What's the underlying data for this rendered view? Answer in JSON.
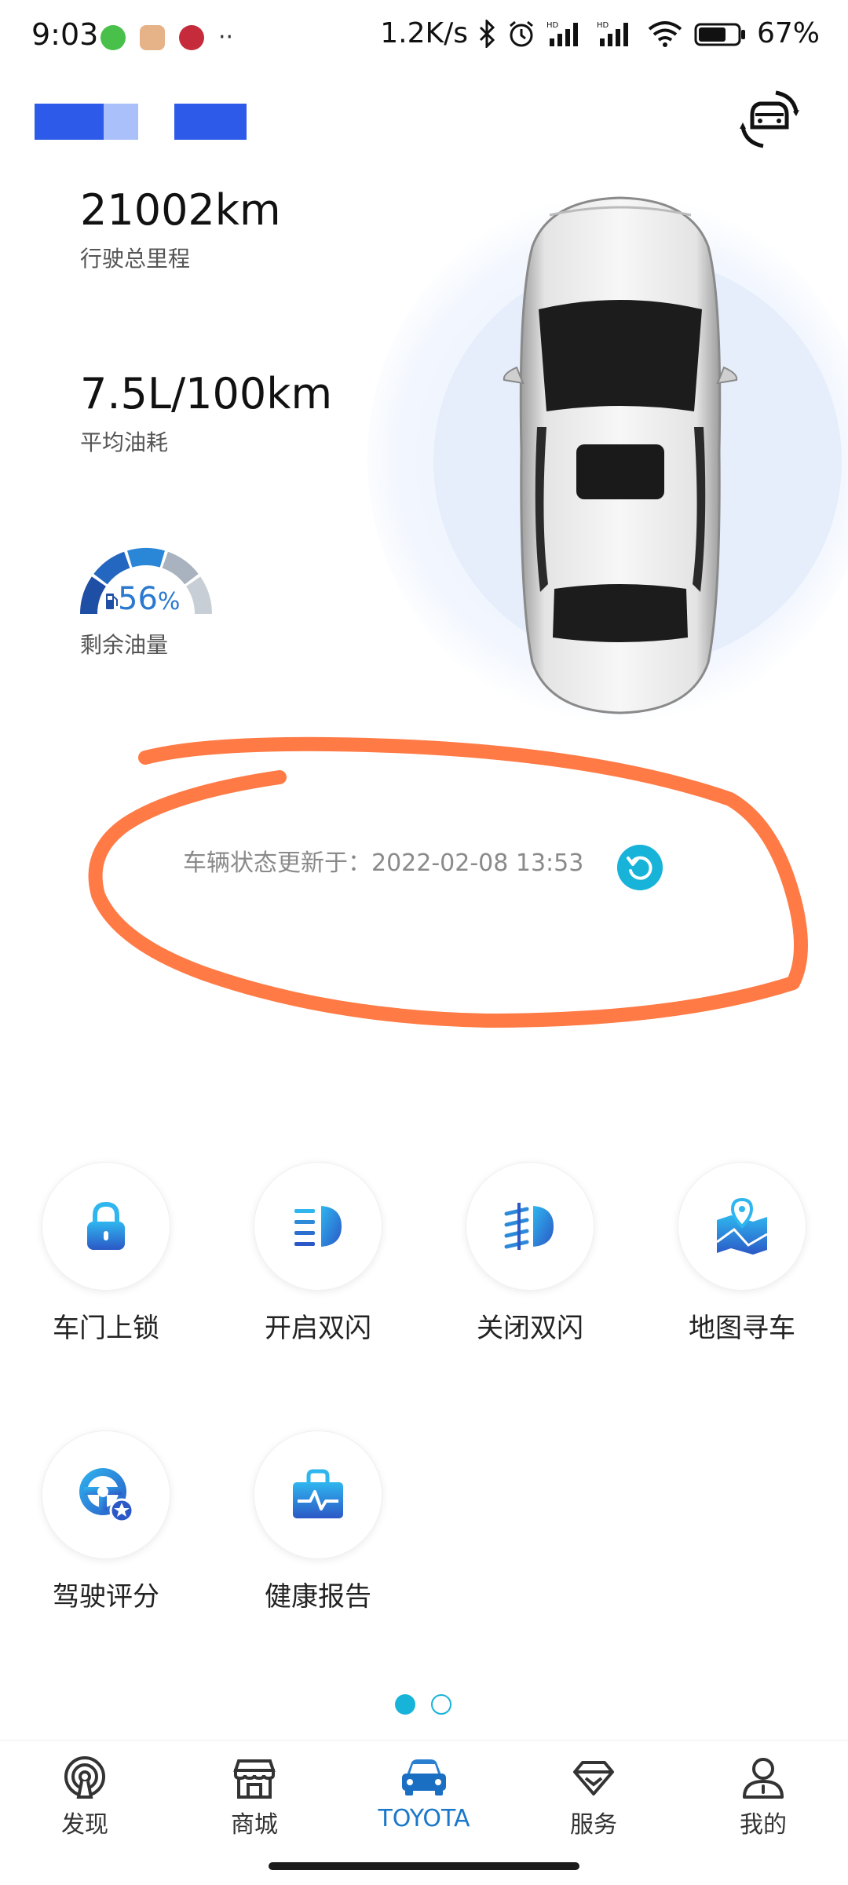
{
  "status_bar": {
    "time": "9:03",
    "net_speed": "1.2K/s",
    "battery": "67%",
    "icons": [
      "wechat-icon",
      "taobao-icon",
      "app-icon",
      "more-icon",
      "bluetooth-icon",
      "alarm-icon",
      "signal-hd-1-icon",
      "signal-hd-2-icon",
      "wifi-icon",
      "battery-icon"
    ]
  },
  "vehicle": {
    "mileage": {
      "value": "21002km",
      "label": "行驶总里程"
    },
    "fuel_consumption": {
      "value": "7.5L/100km",
      "label": "平均油耗"
    },
    "fuel_level": {
      "value": "56",
      "unit": "%",
      "label": "剩余油量",
      "fraction": 0.56
    },
    "update": {
      "text": "车辆状态更新于：2022-02-08 13:53"
    }
  },
  "actions": [
    {
      "label": "车门上锁",
      "icon": "lock-icon"
    },
    {
      "label": "开启双闪",
      "icon": "hazard-on-icon"
    },
    {
      "label": "关闭双闪",
      "icon": "hazard-off-icon"
    },
    {
      "label": "地图寻车",
      "icon": "map-pin-icon"
    },
    {
      "label": "驾驶评分",
      "icon": "steering-wheel-star-icon"
    },
    {
      "label": "健康报告",
      "icon": "health-report-icon"
    }
  ],
  "pager": {
    "count": 2,
    "active": 0
  },
  "bottom_nav": [
    {
      "label": "发现",
      "icon": "discover-icon"
    },
    {
      "label": "商城",
      "icon": "store-icon"
    },
    {
      "label": "TOYOTA",
      "icon": "car-icon",
      "active": true
    },
    {
      "label": "服务",
      "icon": "diamond-icon"
    },
    {
      "label": "我的",
      "icon": "profile-icon"
    }
  ],
  "colors": {
    "accent": "#18b3d9",
    "nav_active": "#1a77c9",
    "brand_blue": "#2d5ae8",
    "annotation": "#ff7a45"
  }
}
